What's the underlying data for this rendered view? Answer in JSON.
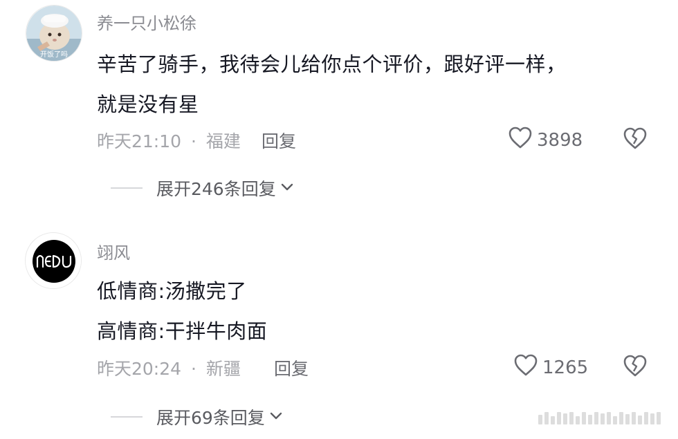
{
  "comments": [
    {
      "username": "养一只小松徐",
      "avatar_caption": "开饭了吗",
      "text_lines": [
        "辛苦了骑手，我待会儿给你点个评价，跟好评一样，",
        "就是没有星"
      ],
      "time": "昨天21:10",
      "location": "福建",
      "meta_separator": "·",
      "reply_label": "回复",
      "likes": "3898",
      "expand_label": "展开246条回复"
    },
    {
      "username": "翊风",
      "avatar_logo_text": "NEDU",
      "text_lines": [
        "低情商:汤撒完了",
        "高情商:干拌牛肉面"
      ],
      "time": "昨天20:24",
      "location": "新疆",
      "meta_separator": "·",
      "reply_label": "回复",
      "likes": "1265",
      "expand_label": "展开69条回复"
    }
  ],
  "icons": {
    "like": "heart-outline-icon",
    "dislike": "broken-heart-icon",
    "expand": "chevron-down-icon"
  },
  "colors": {
    "username": "#8a8b91",
    "body_text": "#161823",
    "meta": "#a4a5aa",
    "action": "#6b6c72"
  }
}
